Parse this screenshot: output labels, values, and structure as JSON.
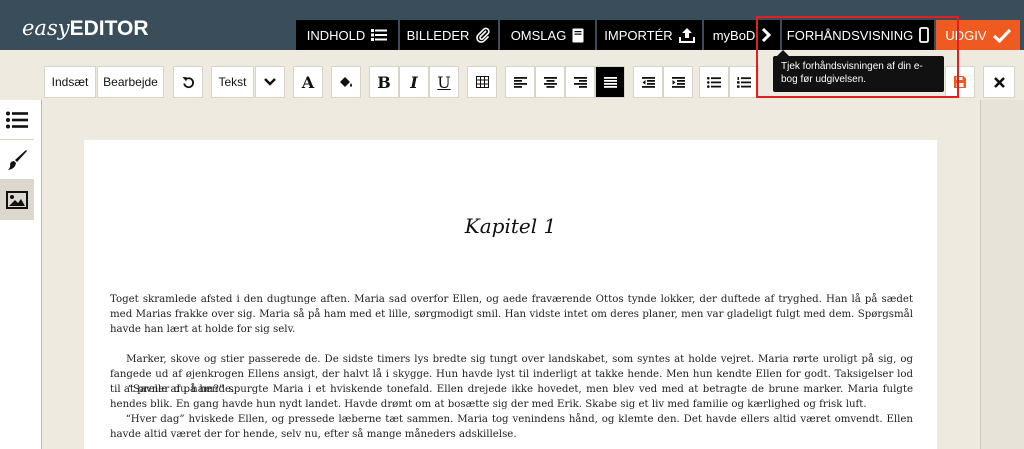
{
  "header": {
    "logo_easy": "easy",
    "logo_editor": "EDITOR",
    "nav": {
      "contents": "INDHOLD",
      "images": "BILLEDER",
      "cover": "OMSLAG",
      "import": "IMPORTÉR",
      "mybod": "myBoD",
      "preview": "FORHÅNDSVISNING",
      "publish": "UDGIV"
    },
    "tooltip": "Tjek forhåndsvisningen af din e-bog før udgivelsen."
  },
  "toolbar": {
    "insert": "Indsæt",
    "edit": "Bearbejde",
    "style_select": "Tekst",
    "font_color_glyph": "A",
    "bold_glyph": "B",
    "italic_glyph": "I",
    "underline_glyph": "U"
  },
  "icons": {
    "contents": "list-icon",
    "images": "paperclip-icon",
    "cover": "book-icon",
    "import": "upload-icon",
    "mybod": "chevron-right-icon",
    "preview": "phone-icon",
    "publish": "checkmark-icon",
    "undo": "undo-icon",
    "dropdown": "chevron-down-icon",
    "fill": "paint-bucket-icon",
    "table": "table-icon",
    "align_left": "align-left-icon",
    "align_center": "align-center-icon",
    "align_right": "align-right-icon",
    "justify": "align-justify-icon",
    "indent_decrease": "indent-decrease-icon",
    "indent_increase": "indent-increase-icon",
    "bullet_list": "bullet-list-icon",
    "numbered_list": "numbered-list-icon",
    "save": "save-icon",
    "close": "close-icon",
    "sidebar_toc": "list-icon",
    "sidebar_style": "brush-icon",
    "sidebar_image": "image-icon"
  },
  "colors": {
    "header_bg": "#3a4d5a",
    "publish_accent": "#ee5a20",
    "highlight": "#e02020"
  },
  "document": {
    "chapter_title": "Kapitel 1",
    "paragraphs": [
      "Toget skramlede afsted i den dugtunge aften. Maria sad overfor Ellen, og aede fraværende Ottos tynde lokker, der duftede af tryghed. Han lå på sædet med Marias frakke over sig. Maria så på ham med et lille, sørgmodigt smil. Han vidste intet om deres planer, men var gladeligt fulgt med dem. Spørgsmål havde han lært at holde for sig selv.",
      "    Marker, skove og stier passerede de. De sidste timers lys bredte sig tungt over landskabet, som syntes at holde vejret. Maria rørte uroligt på sig, og fangede ud af øjenkrogen Ellens ansigt, der halvt lå i skygge. Hun havde lyst til inderligt at takke hende. Men hun kendte Ellen for godt. Taksigelser lod til at prelle af på hende.",
      "    “Savner du ham?” spurgte Maria i et hviskende tonefald. Ellen drejede ikke hovedet, men blev ved med at betragte de brune marker. Maria fulgte hendes blik. En gang havde hun nydt landet. Havde drømt om at bosætte sig der med Erik. Skabe sig et liv med familie og kærlighed og frisk luft.",
      "    “Hver dag” hviskede Ellen, og pressede læberne tæt sammen. Maria tog venindens hånd, og klemte den. Det havde ellers altid været omvendt. Ellen havde altid været der for hende, selv nu, efter så mange måneders adskillelse."
    ]
  }
}
